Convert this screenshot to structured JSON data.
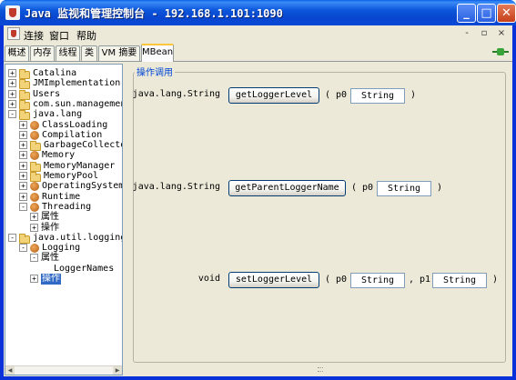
{
  "window": {
    "title": "Java 监视和管理控制台 - 192.168.1.101:1090",
    "minimize_label": "_",
    "maximize_label": "□",
    "close_label": "✕"
  },
  "menubar": {
    "items": [
      "连接",
      "窗口",
      "帮助"
    ],
    "mdi": [
      "-",
      "▫",
      "×"
    ]
  },
  "tabs": [
    "概述",
    "内存",
    "线程",
    "类",
    "VM 摘要",
    "MBean"
  ],
  "active_tab": "MBean",
  "connection_icon": "plug-connected-icon",
  "tree": {
    "items": [
      {
        "label": "Catalina",
        "icon": "folder-icon",
        "expander": "+"
      },
      {
        "label": "JMImplementation",
        "icon": "folder-icon",
        "expander": "+"
      },
      {
        "label": "Users",
        "icon": "folder-icon",
        "expander": "+"
      },
      {
        "label": "com.sun.management",
        "icon": "folder-icon",
        "expander": "+"
      },
      {
        "label": "java.lang",
        "icon": "folder-icon",
        "expander": "-"
      },
      {
        "label": "ClassLoading",
        "icon": "bean-icon",
        "expander": "+"
      },
      {
        "label": "Compilation",
        "icon": "bean-icon",
        "expander": "+"
      },
      {
        "label": "GarbageCollector",
        "icon": "folder-icon",
        "expander": "+"
      },
      {
        "label": "Memory",
        "icon": "bean-icon",
        "expander": "+"
      },
      {
        "label": "MemoryManager",
        "icon": "folder-icon",
        "expander": "+"
      },
      {
        "label": "MemoryPool",
        "icon": "folder-icon",
        "expander": "+"
      },
      {
        "label": "OperatingSystem",
        "icon": "bean-icon",
        "expander": "+"
      },
      {
        "label": "Runtime",
        "icon": "bean-icon",
        "expander": "+"
      },
      {
        "label": "Threading",
        "icon": "bean-icon",
        "expander": "-"
      },
      {
        "label": "属性",
        "icon": "",
        "expander": "+"
      },
      {
        "label": "操作",
        "icon": "",
        "expander": "+"
      },
      {
        "label": "java.util.logging",
        "icon": "folder-icon",
        "expander": "-"
      },
      {
        "label": "Logging",
        "icon": "bean-icon",
        "expander": "-"
      },
      {
        "label": "属性",
        "icon": "",
        "expander": "-"
      },
      {
        "label": "LoggerNames",
        "icon": "",
        "expander": ""
      },
      {
        "label": "操作",
        "icon": "",
        "expander": "+"
      }
    ],
    "selected": "操作"
  },
  "operations": {
    "title": "操作调用",
    "rows": [
      {
        "return_type": "java.lang.String",
        "name": "getLoggerLevel",
        "open": "( p0",
        "params": [
          "String"
        ],
        "separators": [],
        "close": ")"
      },
      {
        "return_type": "java.lang.String",
        "name": "getParentLoggerName",
        "open": "( p0",
        "params": [
          "String"
        ],
        "separators": [],
        "close": ")"
      },
      {
        "return_type": "void",
        "name": "setLoggerLevel",
        "open": "( p0",
        "params": [
          "String",
          "String"
        ],
        "separators": [
          ", p1"
        ],
        "close": ")"
      }
    ]
  },
  "colors": {
    "titlebar": "#0a49d5",
    "panel_bg": "#ece9d8",
    "accent_title": "#0046d5",
    "selection": "#316ac5"
  }
}
